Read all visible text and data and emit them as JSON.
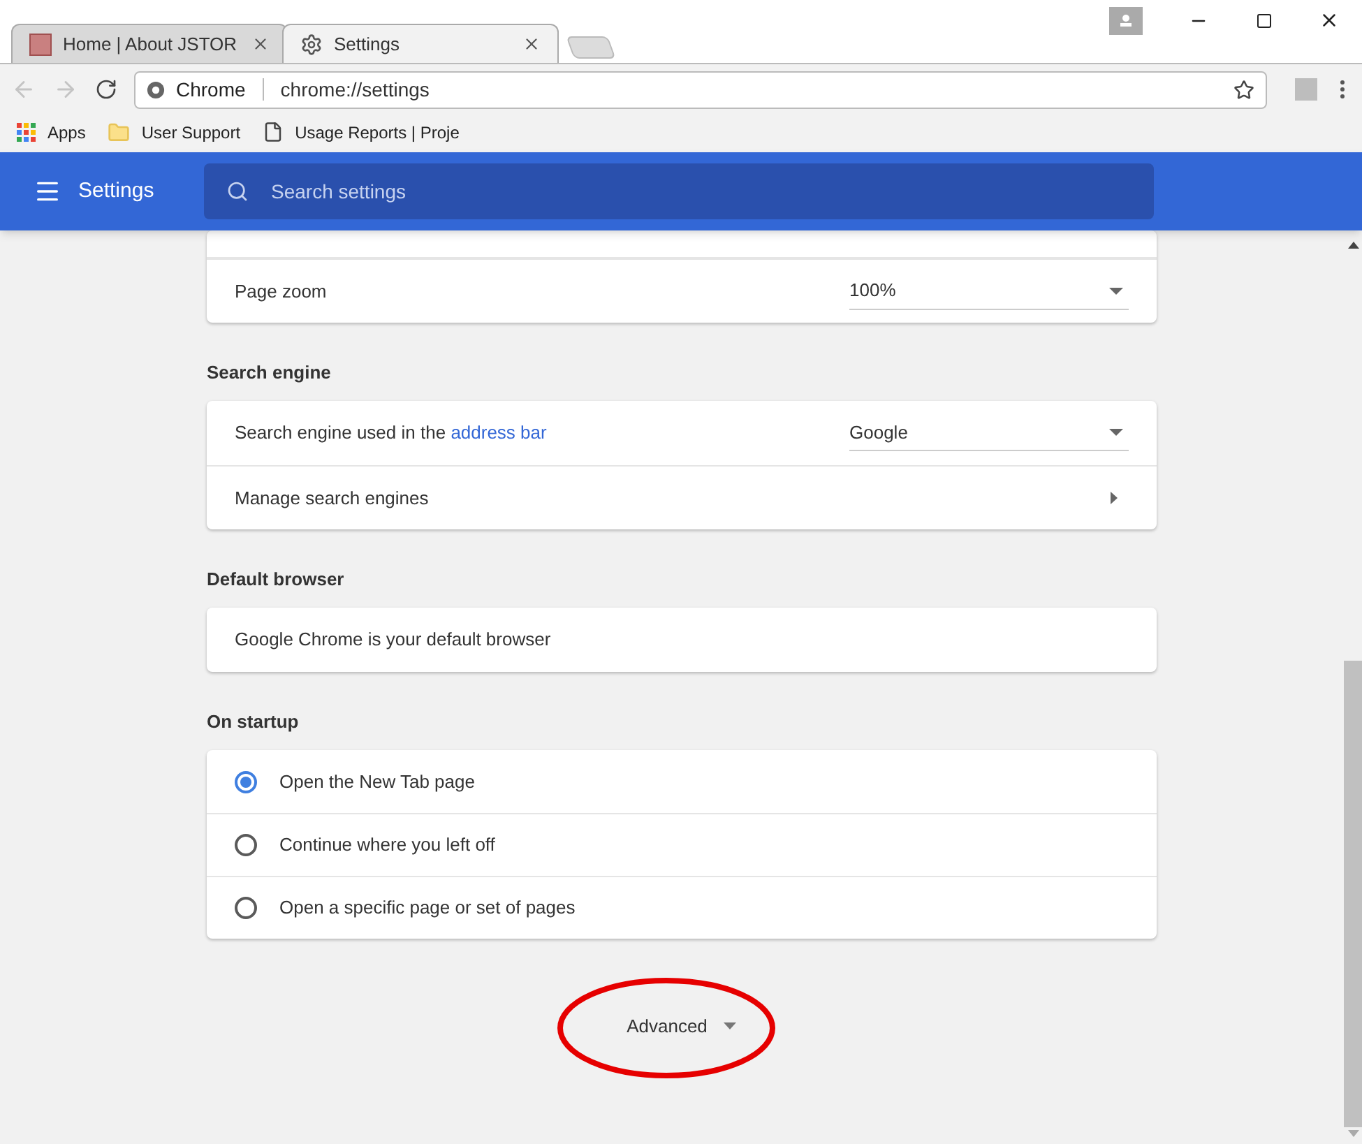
{
  "tabs": [
    {
      "label": "Home | About JSTOR",
      "kind": "site",
      "selected": false
    },
    {
      "label": "Settings",
      "kind": "settings",
      "selected": true
    }
  ],
  "address_bar": {
    "site_label": "Chrome",
    "url": "chrome://settings"
  },
  "bookmarks": [
    {
      "label": "Apps",
      "kind": "apps"
    },
    {
      "label": "User Support",
      "kind": "folder"
    },
    {
      "label": "Usage Reports | Proje",
      "kind": "page"
    }
  ],
  "header": {
    "title": "Settings",
    "search_placeholder": "Search settings"
  },
  "sections": [
    {
      "rows": [
        {
          "kind": "dropdown",
          "label": "Page zoom",
          "value": "100%"
        }
      ]
    },
    {
      "heading": "Search engine",
      "rows": [
        {
          "kind": "dropdown",
          "label": "Search engine used in the",
          "link": "address bar",
          "value": "Google"
        },
        {
          "kind": "arrow",
          "label": "Manage search engines"
        }
      ]
    },
    {
      "heading": "Default browser",
      "rows": [
        {
          "kind": "text",
          "label": "Google Chrome is your default browser"
        }
      ]
    },
    {
      "heading": "On startup",
      "rows": [
        {
          "kind": "radio",
          "label": "Open the New Tab page",
          "selected": true
        },
        {
          "kind": "radio",
          "label": "Continue where you left off",
          "selected": false
        },
        {
          "kind": "radio",
          "label": "Open a specific page or set of pages",
          "selected": false
        }
      ]
    }
  ],
  "advanced": {
    "label": "Advanced",
    "circled": true
  }
}
